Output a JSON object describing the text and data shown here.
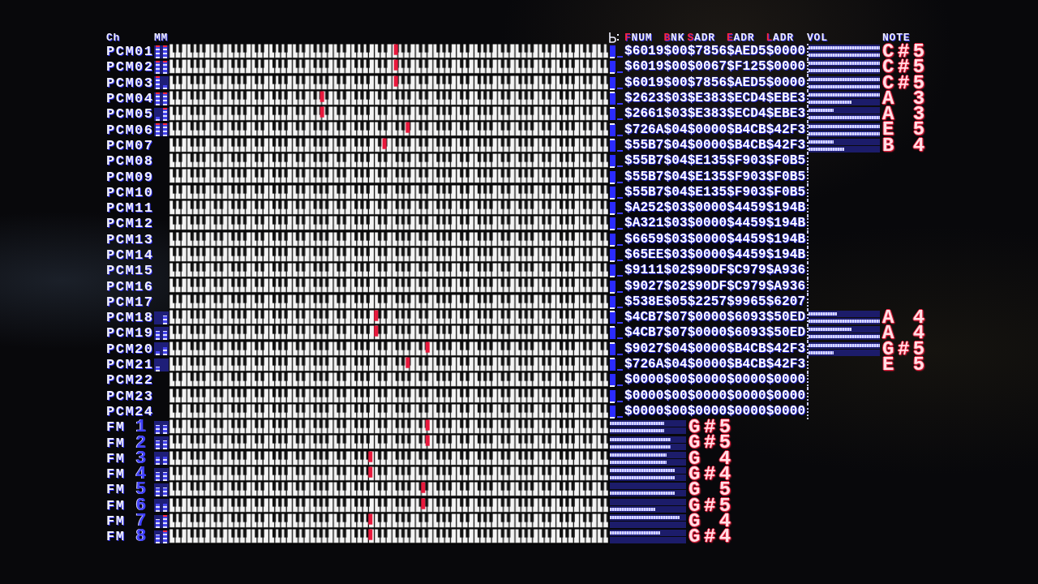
{
  "header": {
    "channel": "Ch",
    "meter": "MM",
    "columns": [
      {
        "label": "FNUM",
        "accent": true
      },
      {
        "label": "BNK",
        "accent": true
      },
      {
        "label": "SADR",
        "accent": true
      },
      {
        "label": "EADR",
        "accent": true
      },
      {
        "label": "LADR",
        "accent": true
      },
      {
        "label": "VOL",
        "accent": false
      },
      {
        "label": "NOTE",
        "accent": false
      }
    ]
  },
  "channels": [
    {
      "kind": "pcm",
      "name": "PCM01",
      "meter": {
        "left": {
          "level": 1
        },
        "right": {
          "level": 1
        }
      },
      "pressed_key": {
        "level": 0.517
      },
      "key_on": false,
      "registers": {
        "fnum": "$6019",
        "bnk": "$00",
        "sadr": "$7856",
        "eadr": "$AED5",
        "ladr": "$0000"
      },
      "vol": {
        "top": {
          "level": 1
        },
        "bottom": {
          "level": 1
        }
      },
      "note": "C#5"
    },
    {
      "kind": "pcm",
      "name": "PCM02",
      "meter": {
        "left": {
          "level": 1
        },
        "right": {
          "level": 1
        }
      },
      "pressed_key": {
        "level": 0.517
      },
      "key_on": false,
      "registers": {
        "fnum": "$6019",
        "bnk": "$00",
        "sadr": "$0067",
        "eadr": "$F125",
        "ladr": "$0000"
      },
      "vol": {
        "top": {
          "level": 1
        },
        "bottom": {
          "level": 1
        }
      },
      "note": "C#5"
    },
    {
      "kind": "pcm",
      "name": "PCM03",
      "meter": {
        "left": {
          "level": 1
        },
        "right": {
          "level": 0.33
        }
      },
      "pressed_key": {
        "level": 0.517
      },
      "key_on": false,
      "registers": {
        "fnum": "$6019",
        "bnk": "$00",
        "sadr": "$7856",
        "eadr": "$AED5",
        "ladr": "$0000"
      },
      "vol": {
        "top": {
          "level": 1
        },
        "bottom": {
          "level": 1
        }
      },
      "note": "C#5"
    },
    {
      "kind": "pcm",
      "name": "PCM04",
      "meter": {
        "left": {
          "level": 1
        },
        "right": {
          "level": 1
        }
      },
      "pressed_key": {
        "level": 0.349
      },
      "key_on": true,
      "registers": {
        "fnum": "$2623",
        "bnk": "$03",
        "sadr": "$E383",
        "eadr": "$ECD4",
        "ladr": "$EBE3"
      },
      "vol": {
        "top": {
          "level": 1
        },
        "bottom": {
          "level": 0.6
        }
      },
      "note": "A 3"
    },
    {
      "kind": "pcm",
      "name": "PCM05",
      "meter": {
        "left": {
          "level": 0.33
        },
        "right": {
          "level": 1
        }
      },
      "pressed_key": {
        "level": 0.349
      },
      "key_on": true,
      "registers": {
        "fnum": "$2661",
        "bnk": "$03",
        "sadr": "$E383",
        "eadr": "$ECD4",
        "ladr": "$EBE3"
      },
      "vol": {
        "top": {
          "level": 0.35
        },
        "bottom": {
          "level": 1
        }
      },
      "note": "A 3"
    },
    {
      "kind": "pcm",
      "name": "PCM06",
      "meter": {
        "left": {
          "level": 1
        },
        "right": {
          "level": 1
        }
      },
      "pressed_key": {
        "level": 0.544
      },
      "key_on": true,
      "registers": {
        "fnum": "$726A",
        "bnk": "$04",
        "sadr": "$0000",
        "eadr": "$B4CB",
        "ladr": "$42F3"
      },
      "vol": {
        "top": {
          "level": 1
        },
        "bottom": {
          "level": 1
        }
      },
      "note": "E 5"
    },
    {
      "kind": "pcm",
      "name": "PCM07",
      "pressed_key": {
        "level": 0.491
      },
      "key_on": true,
      "registers": {
        "fnum": "$55B7",
        "bnk": "$04",
        "sadr": "$0000",
        "eadr": "$B4CB",
        "ladr": "$42F3"
      },
      "vol": {
        "top": {
          "level": 0.35
        },
        "bottom": {
          "level": 0.5
        }
      },
      "note": "B 4"
    },
    {
      "kind": "pcm",
      "name": "PCM08",
      "key_on": false,
      "registers": {
        "fnum": "$55B7",
        "bnk": "$04",
        "sadr": "$E135",
        "eadr": "$F903",
        "ladr": "$F0B5"
      }
    },
    {
      "kind": "pcm",
      "name": "PCM09",
      "key_on": false,
      "registers": {
        "fnum": "$55B7",
        "bnk": "$04",
        "sadr": "$E135",
        "eadr": "$F903",
        "ladr": "$F0B5"
      }
    },
    {
      "kind": "pcm",
      "name": "PCM10",
      "key_on": false,
      "registers": {
        "fnum": "$55B7",
        "bnk": "$04",
        "sadr": "$E135",
        "eadr": "$F903",
        "ladr": "$F0B5"
      }
    },
    {
      "kind": "pcm",
      "name": "PCM11",
      "key_on": false,
      "registers": {
        "fnum": "$A252",
        "bnk": "$03",
        "sadr": "$0000",
        "eadr": "$4459",
        "ladr": "$194B"
      }
    },
    {
      "kind": "pcm",
      "name": "PCM12",
      "key_on": false,
      "registers": {
        "fnum": "$A321",
        "bnk": "$03",
        "sadr": "$0000",
        "eadr": "$4459",
        "ladr": "$194B"
      }
    },
    {
      "kind": "pcm",
      "name": "PCM13",
      "key_on": false,
      "registers": {
        "fnum": "$6659",
        "bnk": "$03",
        "sadr": "$0000",
        "eadr": "$4459",
        "ladr": "$194B"
      }
    },
    {
      "kind": "pcm",
      "name": "PCM14",
      "key_on": false,
      "registers": {
        "fnum": "$65EE",
        "bnk": "$03",
        "sadr": "$0000",
        "eadr": "$4459",
        "ladr": "$194B"
      }
    },
    {
      "kind": "pcm",
      "name": "PCM15",
      "key_on": false,
      "registers": {
        "fnum": "$9111",
        "bnk": "$02",
        "sadr": "$90DF",
        "eadr": "$C979",
        "ladr": "$A936"
      }
    },
    {
      "kind": "pcm",
      "name": "PCM16",
      "key_on": false,
      "registers": {
        "fnum": "$9027",
        "bnk": "$02",
        "sadr": "$90DF",
        "eadr": "$C979",
        "ladr": "$A936"
      }
    },
    {
      "kind": "pcm",
      "name": "PCM17",
      "key_on": false,
      "registers": {
        "fnum": "$538E",
        "bnk": "$05",
        "sadr": "$2257",
        "eadr": "$9965",
        "ladr": "$6207"
      }
    },
    {
      "kind": "pcm",
      "name": "PCM18",
      "meter": {
        "right": {
          "level": 0.67
        }
      },
      "pressed_key": {
        "level": 0.472
      },
      "key_on": true,
      "registers": {
        "fnum": "$4CB7",
        "bnk": "$07",
        "sadr": "$0000",
        "eadr": "$6093",
        "ladr": "$50ED"
      },
      "vol": {
        "top": {
          "level": 0.4
        },
        "bottom": {
          "level": 1
        }
      },
      "note": "A 4"
    },
    {
      "kind": "pcm",
      "name": "PCM19",
      "meter": {
        "left": {
          "level": 0.67
        },
        "right": {
          "level": 0.67
        }
      },
      "pressed_key": {
        "level": 0.472
      },
      "key_on": true,
      "registers": {
        "fnum": "$4CB7",
        "bnk": "$07",
        "sadr": "$0000",
        "eadr": "$6093",
        "ladr": "$50ED"
      },
      "vol": {
        "top": {
          "level": 0.6
        },
        "bottom": {
          "level": 1
        }
      },
      "note": "A 4"
    },
    {
      "kind": "pcm",
      "name": "PCM20",
      "meter": {
        "left": {
          "level": 0.33
        },
        "right": {
          "level": 0.67
        }
      },
      "pressed_key": {
        "level": 0.589
      },
      "key_on": true,
      "registers": {
        "fnum": "$9027",
        "bnk": "$04",
        "sadr": "$0000",
        "eadr": "$B4CB",
        "ladr": "$42F3"
      },
      "vol": {
        "top": {
          "level": 1
        },
        "bottom": {
          "level": 0.35
        }
      },
      "note": "G#5"
    },
    {
      "kind": "pcm",
      "name": "PCM21",
      "meter": {
        "left": {
          "level": 0.33
        }
      },
      "pressed_key": {
        "level": 0.544
      },
      "key_on": true,
      "registers": {
        "fnum": "$726A",
        "bnk": "$04",
        "sadr": "$0000",
        "eadr": "$B4CB",
        "ladr": "$42F3"
      },
      "note": "E 5"
    },
    {
      "kind": "pcm",
      "name": "PCM22",
      "key_on": false,
      "registers": {
        "fnum": "$0000",
        "bnk": "$00",
        "sadr": "$0000",
        "eadr": "$0000",
        "ladr": "$0000"
      }
    },
    {
      "kind": "pcm",
      "name": "PCM23",
      "key_on": false,
      "registers": {
        "fnum": "$0000",
        "bnk": "$00",
        "sadr": "$0000",
        "eadr": "$0000",
        "ladr": "$0000"
      }
    },
    {
      "kind": "pcm",
      "name": "PCM24",
      "key_on": false,
      "registers": {
        "fnum": "$0000",
        "bnk": "$00",
        "sadr": "$0000",
        "eadr": "$0000",
        "ladr": "$0000"
      }
    },
    {
      "kind": "fm",
      "label": "FM",
      "number": "1",
      "meter": {
        "left": {
          "level": 0.67
        },
        "right": {
          "level": 0.67
        }
      },
      "pressed_key": {
        "level": 0.589
      },
      "vol": {
        "top": {
          "level": 0.71
        },
        "bottom": {
          "level": 0.71
        }
      },
      "note": "G#5"
    },
    {
      "kind": "fm",
      "label": "FM",
      "number": "2",
      "meter": {
        "left": {
          "level": 0.67
        },
        "right": {
          "level": 0.67
        }
      },
      "pressed_key": {
        "level": 0.589
      },
      "vol": {
        "top": {
          "level": 0.8
        },
        "bottom": {
          "level": 0.8
        }
      },
      "note": "G#5"
    },
    {
      "kind": "fm",
      "label": "FM",
      "number": "3",
      "meter": {
        "left": {
          "level": 0.67
        },
        "right": {
          "level": 0.67
        }
      },
      "pressed_key": {
        "level": 0.459
      },
      "vol": {
        "top": {
          "level": 0.74
        },
        "bottom": {
          "level": 0.74
        }
      },
      "note": "G 4"
    },
    {
      "kind": "fm",
      "label": "FM",
      "number": "4",
      "meter": {
        "left": {
          "level": 0.67
        },
        "right": {
          "level": 0.67
        }
      },
      "pressed_key": {
        "level": 0.459
      },
      "vol": {
        "top": {
          "level": 0.85
        },
        "bottom": {
          "level": 0.85
        }
      },
      "note": "G#4"
    },
    {
      "kind": "fm",
      "label": "FM",
      "number": "5",
      "meter": {
        "left": {
          "level": 0.67
        },
        "right": {
          "level": 0.67
        }
      },
      "pressed_key": {
        "level": 0.579
      },
      "vol": {
        "bottom": {
          "level": 0.85
        }
      },
      "note": "G 5"
    },
    {
      "kind": "fm",
      "label": "FM",
      "number": "6",
      "meter": {
        "left": {
          "level": 0.67
        },
        "right": {
          "level": 0.67
        }
      },
      "pressed_key": {
        "level": 0.579
      },
      "vol": {
        "bottom": {
          "level": 0.6
        }
      },
      "note": "G#5"
    },
    {
      "kind": "fm",
      "label": "FM",
      "number": "7",
      "meter": {
        "left": {
          "level": 0.67
        },
        "right": {
          "level": 1
        }
      },
      "pressed_key": {
        "level": 0.459
      },
      "vol": {
        "top": {
          "level": 0.92
        }
      },
      "note": "G 4"
    },
    {
      "kind": "fm",
      "label": "FM",
      "number": "8",
      "meter": {
        "left": {
          "level": 0.67
        },
        "right": {
          "level": 1
        }
      },
      "pressed_key": {
        "level": 0.459
      },
      "vol": {
        "top": {
          "level": 0.66
        }
      },
      "note": "G#4"
    }
  ]
}
